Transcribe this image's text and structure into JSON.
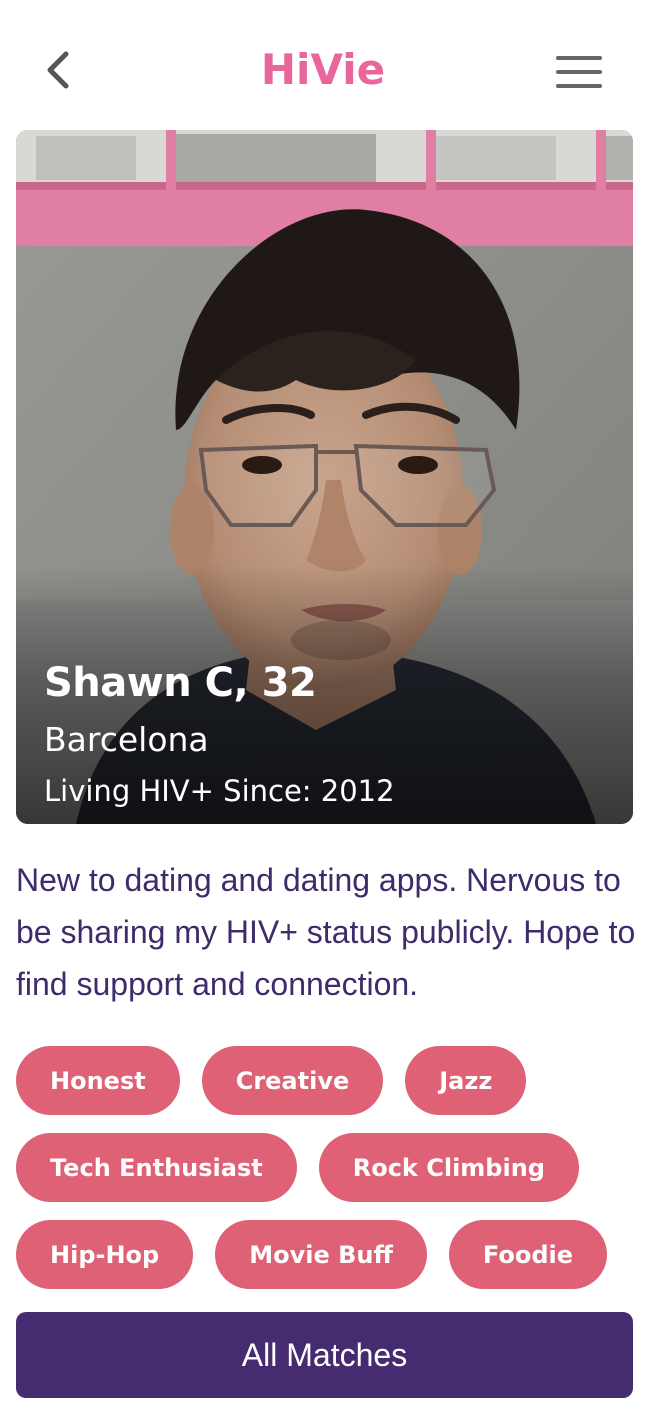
{
  "header": {
    "logo_text": "HiVie",
    "back_icon": "chevron-left-icon",
    "menu_icon": "hamburger-menu-icon"
  },
  "profile": {
    "name_age": "Shawn C, 32",
    "city": "Barcelona",
    "hiv_since": "Living HIV+ Since: 2012",
    "photo_icon": "profile-photo",
    "bio": "New to dating and dating apps. Nervous to be sharing my HIV+ status publicly. Hope to find support and connection."
  },
  "tags": {
    "row1": [
      "Honest",
      "Creative",
      "Jazz"
    ],
    "row2": [
      "Tech Enthusiast",
      "Rock Climbing"
    ],
    "row3": [
      "Hip-Hop",
      "Movie Buff",
      "Foodie"
    ]
  },
  "actions": {
    "all_matches_label": "All Matches"
  },
  "colors": {
    "brand_pink": "#e8669b",
    "tag_bg": "#df6176",
    "primary_purple": "#452c70",
    "bio_text": "#3f2b6b"
  }
}
